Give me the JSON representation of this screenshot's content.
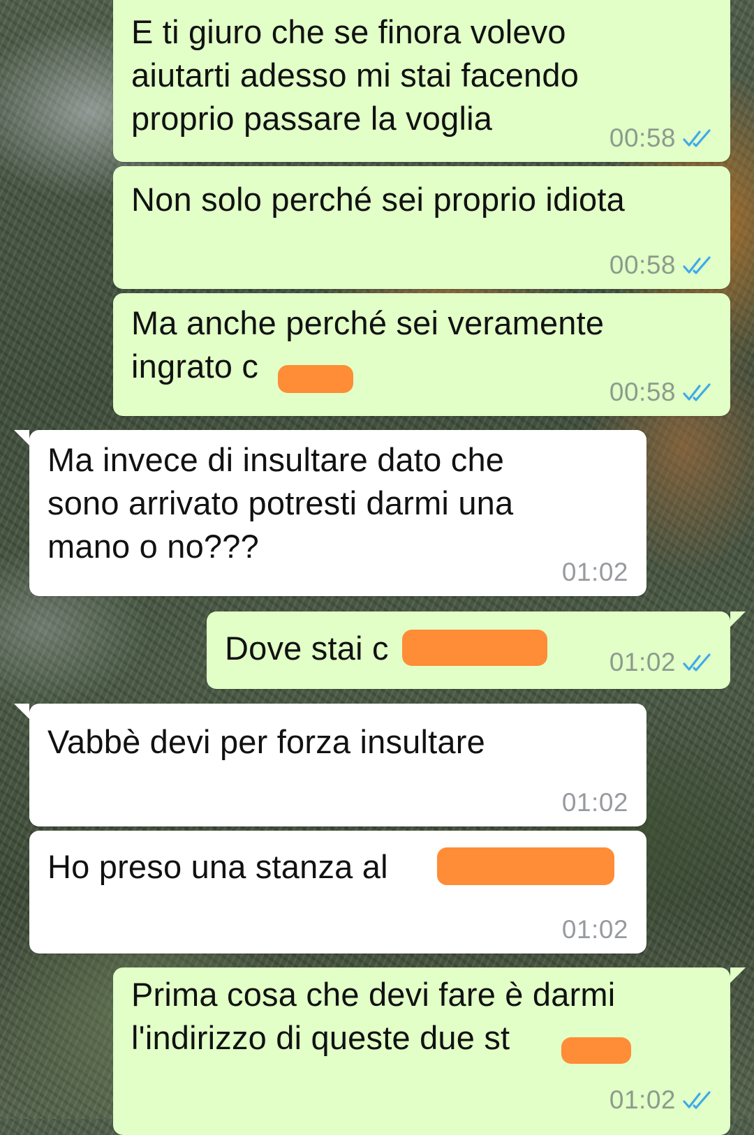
{
  "colors": {
    "outgoing_bubble": "#e1ffc7",
    "incoming_bubble": "#ffffff",
    "read_ticks": "#3fa9ea",
    "redaction": "#ff8c36"
  },
  "messages": [
    {
      "direction": "outgoing",
      "text": "E ti giuro che se finora volevo\naiutarti adesso mi stai facendo\nproprio passare la voglia",
      "time": "00:58",
      "status_icon": "double-check-read-icon"
    },
    {
      "direction": "outgoing",
      "text": "Non solo perché sei proprio idiota",
      "time": "00:58",
      "status_icon": "double-check-read-icon"
    },
    {
      "direction": "outgoing",
      "text": "Ma anche perché sei veramente\ningrato c",
      "time": "00:58",
      "status_icon": "double-check-read-icon",
      "redacted": true
    },
    {
      "direction": "incoming",
      "text": "Ma invece di insultare dato che\nsono arrivato potresti darmi una\nmano o no???",
      "time": "01:02"
    },
    {
      "direction": "outgoing",
      "text": "Dove stai c",
      "time": "01:02",
      "status_icon": "double-check-read-icon",
      "redacted": true
    },
    {
      "direction": "incoming",
      "text": "Vabbè devi per forza insultare",
      "time": "01:02"
    },
    {
      "direction": "incoming",
      "text": "Ho preso una stanza al",
      "time": "01:02",
      "redacted": true
    },
    {
      "direction": "outgoing",
      "text": "Prima cosa che devi fare è darmi\nl'indirizzo di queste due st",
      "time": "01:02",
      "status_icon": "double-check-read-icon",
      "redacted": true
    }
  ]
}
